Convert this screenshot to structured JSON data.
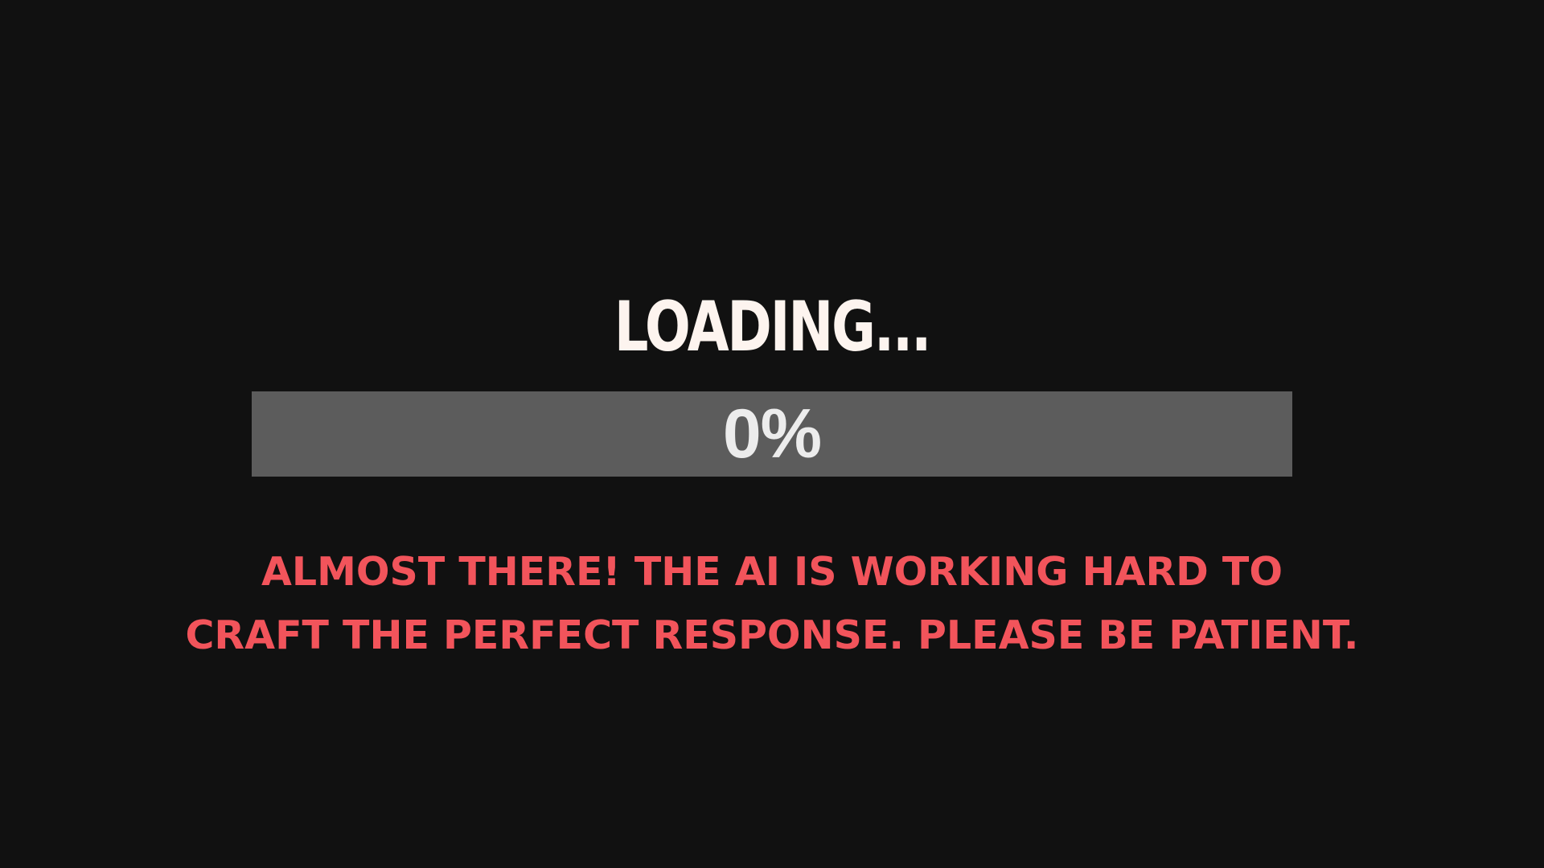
{
  "loader": {
    "title": "LOADING...",
    "progress_label": "0%",
    "progress_fraction": 0,
    "message_lines": [
      "ALMOST THERE! THE AI IS WORKING HARD TO",
      "CRAFT THE PERFECT RESPONSE. PLEASE BE PATIENT."
    ]
  },
  "colors": {
    "background": "#111111",
    "title": "#fdf4ef",
    "track": "#5c5c5c",
    "progress_text": "#ececec",
    "message": "#f2545b"
  }
}
